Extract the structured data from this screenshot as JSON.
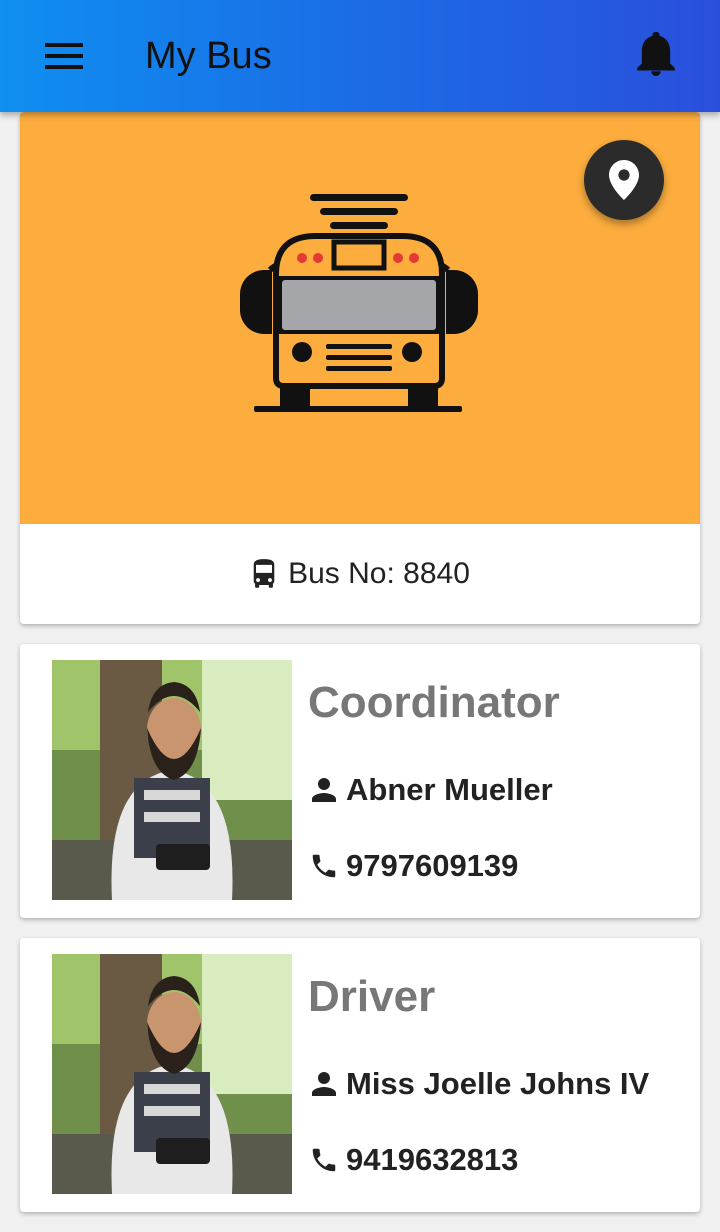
{
  "app_bar": {
    "title": "My Bus",
    "menu_icon": "hamburger-menu-icon",
    "notification_icon": "bell-icon"
  },
  "bus": {
    "number_label": "Bus No: 8840",
    "hero_color": "#fcad3e",
    "location_icon": "map-pin-icon"
  },
  "staff": [
    {
      "role": "Coordinator",
      "name": "Abner Mueller",
      "phone": "9797609139"
    },
    {
      "role": "Driver",
      "name": "Miss Joelle Johns IV",
      "phone": "9419632813"
    }
  ],
  "colors": {
    "appbar_start": "#0f8ff0",
    "appbar_end": "#2a4fdc",
    "role_text": "#777777",
    "fab": "#2b2b2b"
  }
}
